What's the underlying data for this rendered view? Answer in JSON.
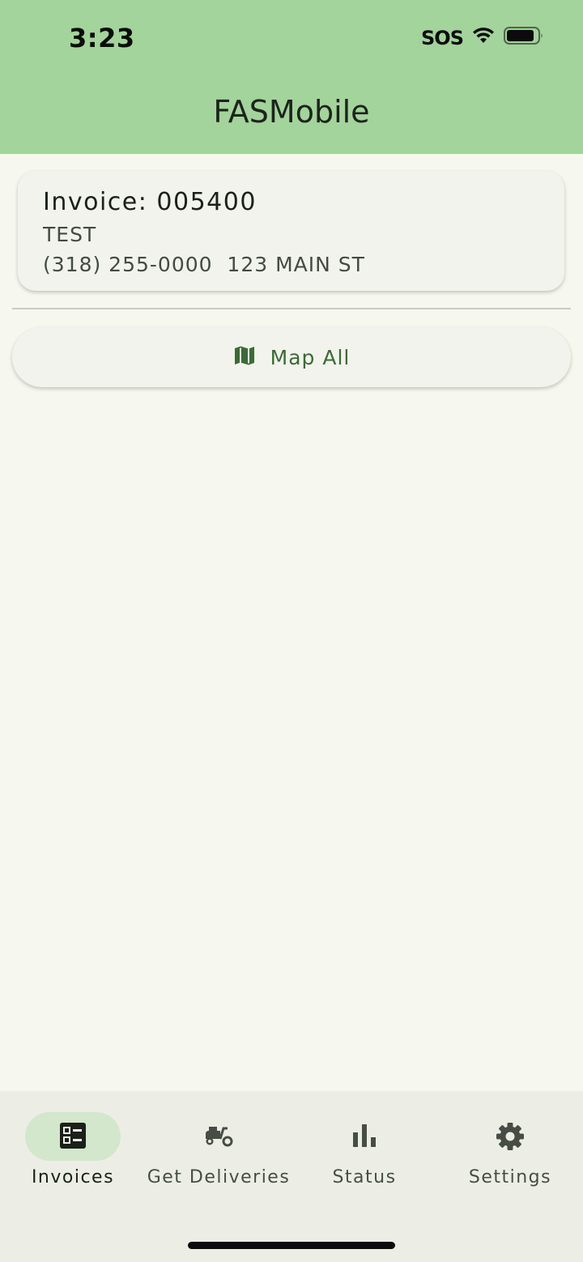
{
  "status_bar": {
    "time": "3:23",
    "carrier": "SOS"
  },
  "app_bar": {
    "title": "FASMobile"
  },
  "invoices": [
    {
      "title": "Invoice: 005400",
      "name": "TEST",
      "phone_address": "(318) 255-0000  123 MAIN ST"
    }
  ],
  "map_all": {
    "label": "Map All",
    "icon": "map-icon"
  },
  "bottom_nav": {
    "items": [
      {
        "label": "Invoices",
        "icon": "invoices-icon",
        "active": true
      },
      {
        "label": "Get Deliveries",
        "icon": "moped-icon",
        "active": false
      },
      {
        "label": "Status",
        "icon": "bar-chart-icon",
        "active": false
      },
      {
        "label": "Settings",
        "icon": "gear-icon",
        "active": false
      }
    ]
  },
  "colors": {
    "app_bar": "#a3d49b",
    "background": "#f6f8f0",
    "accent": "#3c6a36",
    "active_pill": "#d2e7cb"
  }
}
